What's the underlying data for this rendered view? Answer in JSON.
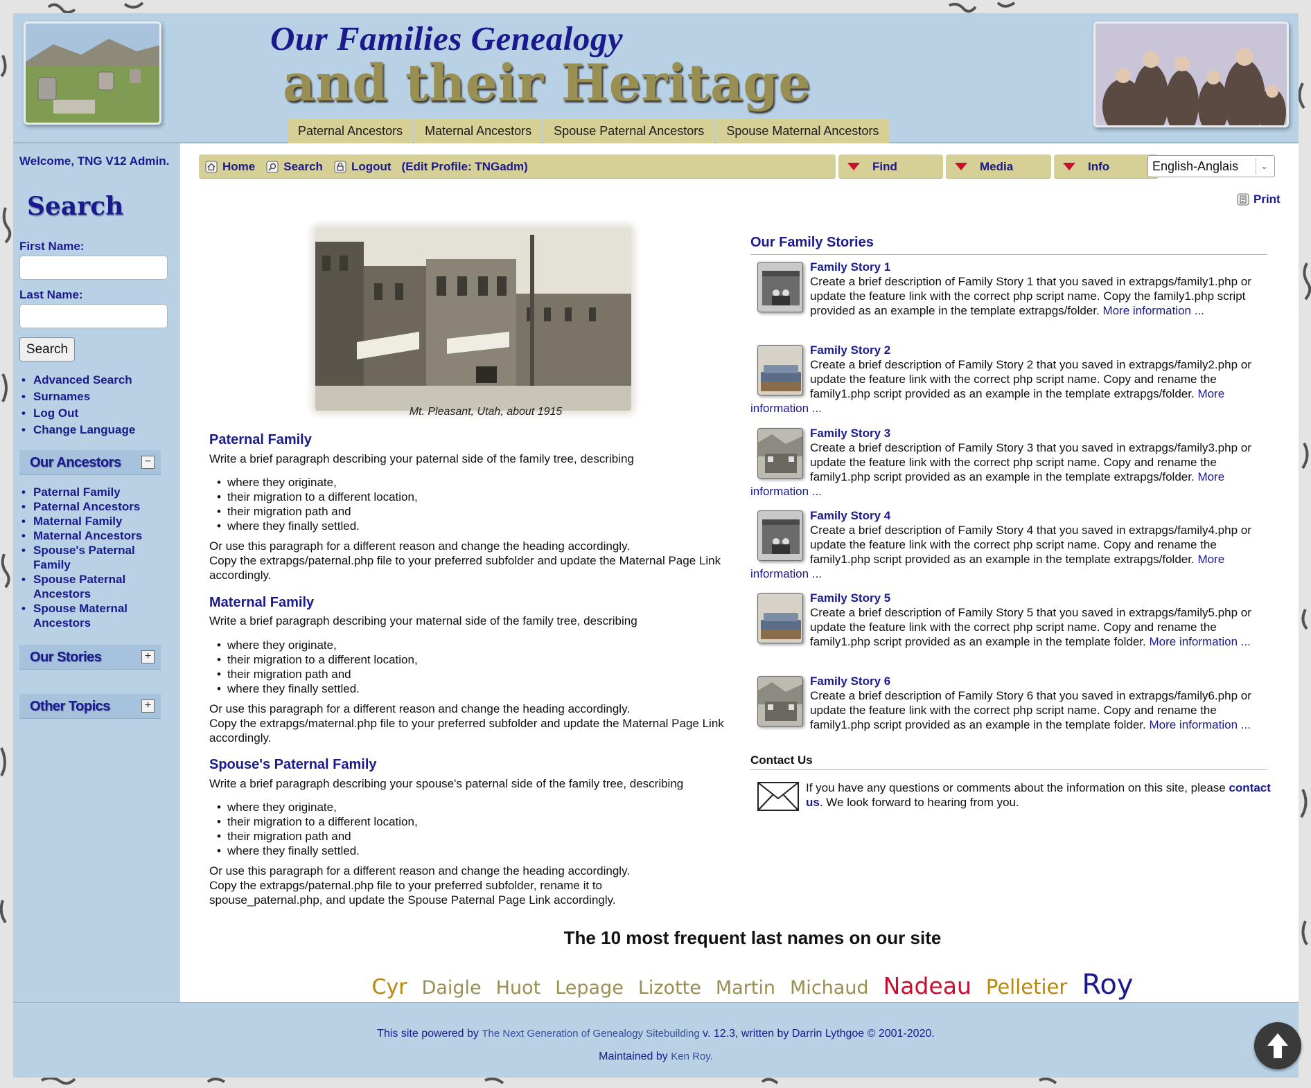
{
  "header": {
    "title_line1": "Our Families Genealogy",
    "title_line2": "and their Heritage",
    "tabs": [
      "Paternal Ancestors",
      "Maternal Ancestors",
      "Spouse Paternal Ancestors",
      "Spouse Maternal Ancestors"
    ]
  },
  "sidebar": {
    "welcome": "Welcome, TNG V12 Admin.",
    "search_title": "Search",
    "first_name_label": "First Name:",
    "first_name_value": "",
    "last_name_label": "Last Name:",
    "last_name_value": "",
    "search_button": "Search",
    "links": [
      "Advanced Search",
      "Surnames",
      "Log Out",
      "Change Language"
    ],
    "ancestors_box": {
      "title": "Our Ancestors",
      "toggle": "−",
      "items": [
        "Paternal Family",
        "Paternal Ancestors",
        "Maternal Family",
        "Maternal Ancestors",
        "Spouse's Paternal Family",
        "Spouse Paternal Ancestors",
        "Spouse Maternal Ancestors"
      ]
    },
    "stories_box": {
      "title": "Our Stories",
      "toggle": "+"
    },
    "topics_box": {
      "title": "Other Topics",
      "toggle": "+"
    }
  },
  "navbar": {
    "home": "Home",
    "search": "Search",
    "logout": "Logout",
    "edit_profile": "(Edit Profile: TNGadm)",
    "find": "Find",
    "media": "Media",
    "info": "Info",
    "language": "English-Anglais",
    "print": "Print"
  },
  "main": {
    "photo_caption": "Mt. Pleasant, Utah, about 1915",
    "sections": [
      {
        "heading": "Paternal Family",
        "intro": "Write a brief paragraph describing your paternal side of the family tree, describing",
        "bullets": [
          "where they originate,",
          "their migration to a different location,",
          "their migration path and",
          "where they finally settled."
        ],
        "outro1": "Or use this paragraph for a different reason and change the heading accordingly.",
        "outro2": "Copy the extrapgs/paternal.php file to your preferred subfolder and update the Maternal Page Link accordingly."
      },
      {
        "heading": "Maternal Family",
        "intro": "Write a brief paragraph describing your maternal side of the family tree, describing",
        "bullets": [
          "where they originate,",
          "their migration to a different location,",
          "their migration path and",
          "where they finally settled."
        ],
        "outro1": "Or use this paragraph for a different reason and change the heading accordingly.",
        "outro2": "Copy the extrapgs/maternal.php file to your preferred subfolder and update the Maternal Page Link accordingly."
      },
      {
        "heading": "Spouse's Paternal Family",
        "intro": "Write a brief paragraph describing your spouse's paternal side of the family tree, describing",
        "bullets": [
          "where they originate,",
          "their migration to a different location,",
          "their migration path and",
          "where they finally settled."
        ],
        "outro1": "Or use this paragraph for a different reason and change the heading accordingly.",
        "outro2": "Copy the extrapgs/paternal.php file to your preferred subfolder, rename it to spouse_paternal.php, and update the Spouse Paternal Page Link accordingly."
      }
    ]
  },
  "stories": {
    "heading": "Our Family Stories",
    "items": [
      {
        "title": "Family Story 1",
        "text": "Create a brief description of Family Story 1 that you saved in extrapgs/family1.php or update the feature link with the correct php script name. Copy the family1.php script provided as an example in the template extrapgs/folder.",
        "more": "More information",
        "ellipsis": "..."
      },
      {
        "title": "Family Story 2",
        "text": "Create a brief description of Family Story 2 that you saved in extrapgs/family2.php or update the feature link with the correct php script name. Copy and rename the family1.php script provided as an example in the template extrapgs/folder.",
        "more": "More information",
        "ellipsis": "..."
      },
      {
        "title": "Family Story 3",
        "text": "Create a brief description of Family Story 3 that you saved in extrapgs/family3.php or update the feature link with the correct php script name. Copy and rename the family1.php script provided as an example in the template extrapgs/folder.",
        "more": "More information",
        "ellipsis": "..."
      },
      {
        "title": "Family Story 4",
        "text": "Create a brief description of Family Story 4 that you saved in extrapgs/family4.php or update the feature link with the correct php script name. Copy and rename the family1.php script provided as an example in the template extrapgs/folder.",
        "more": "More information",
        "ellipsis": "..."
      },
      {
        "title": "Family Story 5",
        "text": "Create a brief description of Family Story 5 that you saved in extrapgs/family5.php or update the feature link with the correct php script name. Copy and rename the family1.php script provided as an example in the template folder.",
        "more": "More information",
        "ellipsis": "..."
      },
      {
        "title": "Family Story 6",
        "text": "Create a brief description of Family Story 6 that you saved in extrapgs/family6.php or update the feature link with the correct php script name. Copy and rename the family1.php script provided as an example in the template folder.",
        "more": "More information",
        "ellipsis": "..."
      }
    ]
  },
  "contact": {
    "heading": "Contact Us",
    "text_before": "If you have any questions or comments about the information on this site, please ",
    "link": "contact us",
    "text_after": ". We look forward to hearing from you."
  },
  "surnames": {
    "heading": "The 10 most frequent last names on our site",
    "names": [
      {
        "name": "Cyr",
        "color": "#b8860b"
      },
      {
        "name": "Daigle",
        "color": "#9a8f52"
      },
      {
        "name": "Huot",
        "color": "#9a8f52"
      },
      {
        "name": "Lepage",
        "color": "#9a8f52"
      },
      {
        "name": "Lizotte",
        "color": "#9a8f52"
      },
      {
        "name": "Martin",
        "color": "#9a8f52"
      },
      {
        "name": "Michaud",
        "color": "#9a8f52"
      },
      {
        "name": "Nadeau",
        "color": "#c8102e"
      },
      {
        "name": "Pelletier",
        "color": "#b8860b"
      },
      {
        "name": "Roy",
        "color": "#1a1a8c"
      }
    ]
  },
  "footer": {
    "powered_prefix": "This site powered by ",
    "powered_link": "The Next Generation of Genealogy Sitebuilding",
    "powered_suffix": " v. 12.3, written by Darrin Lythgoe © 2001-2020.",
    "maintained_prefix": "Maintained by ",
    "maintained_link": "Ken Roy."
  },
  "colors": {
    "header_bg": "#b8d1e5",
    "tab_bg": "#d6cf96",
    "link": "#1a1a8c",
    "title_gold": "#9a8f52"
  }
}
